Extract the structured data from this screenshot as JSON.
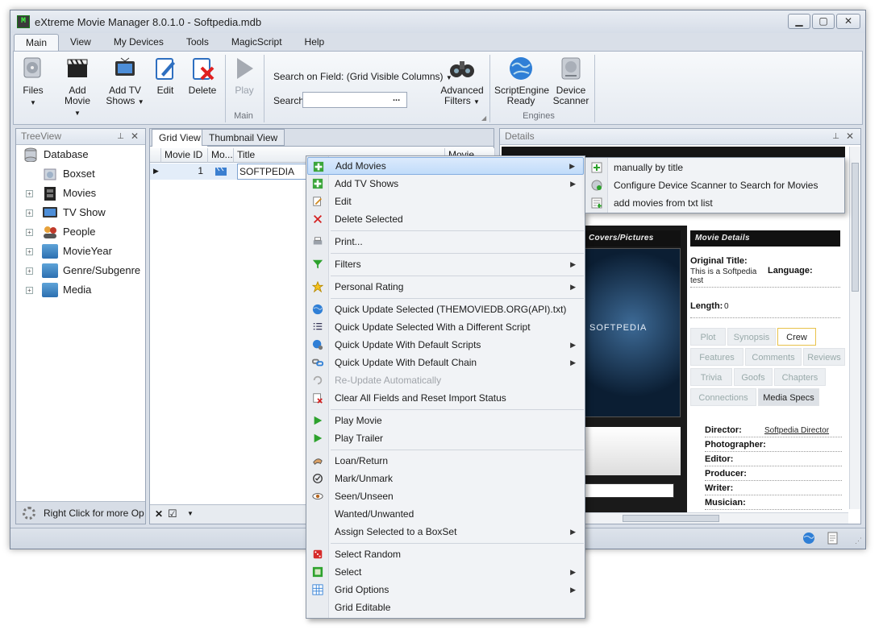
{
  "window": {
    "title": "eXtreme Movie Manager 8.0.1.0 - Softpedia.mdb",
    "minimize": "▁",
    "maximize": "▢",
    "close": "✕"
  },
  "menu_tabs": [
    "Main",
    "View",
    "My Devices",
    "Tools",
    "MagicScript",
    "Help"
  ],
  "ribbon": {
    "files": "Files",
    "add_movie": "Add Movie",
    "add_tv": "Add TV",
    "add_tv2": "Shows",
    "edit": "Edit",
    "delete": "Delete",
    "play": "Play",
    "search_field_label": "Search on Field: (Grid Visible Columns)",
    "search_label": "Search",
    "search_button": "...",
    "adv_filters": "Advanced",
    "adv_filters2": "Filters",
    "group_main": "Main",
    "script_engine": "ScriptEngine",
    "script_engine2": "Ready",
    "device_scanner": "Device",
    "device_scanner2": "Scanner",
    "group_engines": "Engines"
  },
  "treeview": {
    "header": "TreeView",
    "items": [
      "Database",
      "Boxset",
      "Movies",
      "TV Show",
      "People",
      "MovieYear",
      "Genre/Subgenre",
      "Media"
    ],
    "hint": "Right Click for more Op"
  },
  "grid": {
    "tabs": [
      "Grid View",
      "Thumbnail View"
    ],
    "columns": [
      "Movie ID",
      "Mo...",
      "Title",
      "Movie Year"
    ],
    "row": {
      "id": "1",
      "title": "SOFTPEDIA"
    }
  },
  "context_menu": {
    "items": [
      "Add Movies",
      "Add TV Shows",
      "Edit",
      "Delete Selected",
      "Print...",
      "Filters",
      "Personal Rating",
      "Quick Update Selected (THEMOVIEDB.ORG(API).txt)",
      "Quick Update Selected With a Different Script",
      "Quick Update With Default Scripts",
      "Quick Update With Default Chain",
      "Re-Update Automatically",
      "Clear All Fields and Reset Import Status",
      "Play Movie",
      "Play Trailer",
      "Loan/Return",
      "Mark/Unmark",
      "Seen/Unseen",
      "Wanted/Unwanted",
      "Assign Selected to a BoxSet",
      "Select Random",
      "Select",
      "Grid Options",
      "Grid Editable"
    ]
  },
  "submenu": {
    "items": [
      "manually by title",
      "Configure Device Scanner to Search for Movies",
      "add movies from txt list"
    ]
  },
  "details": {
    "header": "Details",
    "pictures_head": "Covers/Pictures",
    "movie_details_head": "Movie Details",
    "original_title_label": "Original Title:",
    "original_title_value": "This is a Softpedia test",
    "language_label": "Language:",
    "length_label": "Length:",
    "length_value": "0",
    "cover_text": "SOFTPEDIA",
    "tabs_row1": [
      "Plot",
      "Synopsis",
      "Crew"
    ],
    "tabs_row2": [
      "Features",
      "Comments",
      "Reviews"
    ],
    "tabs_row3": [
      "Trivia",
      "Goofs",
      "Chapters"
    ],
    "tabs_row4": [
      "Connections",
      "Media Specs"
    ],
    "crew": [
      {
        "label": "Director:",
        "value": "Softpedia Director"
      },
      {
        "label": "Photographer:",
        "value": ""
      },
      {
        "label": "Editor:",
        "value": ""
      },
      {
        "label": "Producer:",
        "value": ""
      },
      {
        "label": "Writer:",
        "value": ""
      },
      {
        "label": "Musician:",
        "value": ""
      }
    ]
  },
  "colors": {
    "accent": "#c1dcfa",
    "ribbon_bg": "#e5eaf1",
    "dark_panel": "#151515"
  }
}
